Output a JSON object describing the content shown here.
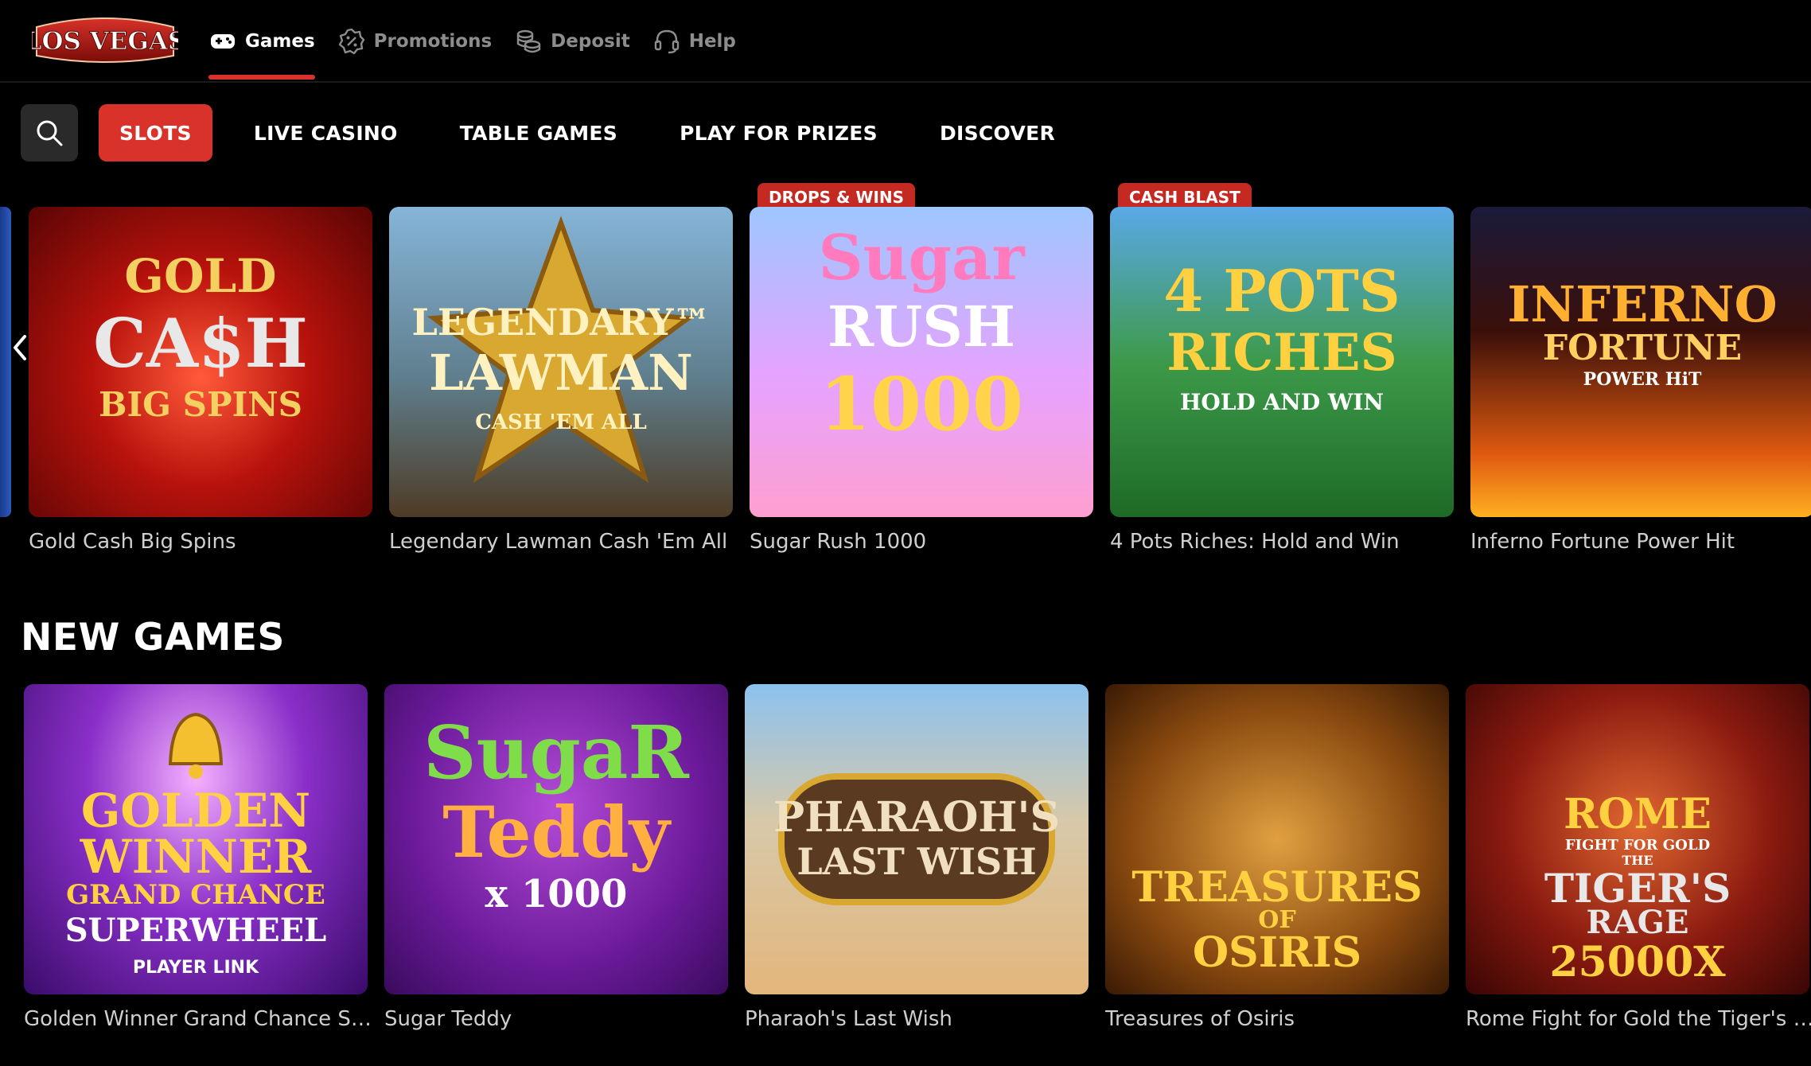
{
  "header": {
    "logo_text": "LOS VEGAS",
    "nav": [
      {
        "label": "Games",
        "icon": "gamepad-icon",
        "active": true
      },
      {
        "label": "Promotions",
        "icon": "percent-badge-icon",
        "active": false
      },
      {
        "label": "Deposit",
        "icon": "coins-icon",
        "active": false
      },
      {
        "label": "Help",
        "icon": "headset-icon",
        "active": false
      }
    ]
  },
  "categories": {
    "search_icon": "search-icon",
    "items": [
      {
        "label": "SLOTS",
        "active": true
      },
      {
        "label": "LIVE CASINO",
        "active": false
      },
      {
        "label": "TABLE GAMES",
        "active": false
      },
      {
        "label": "PLAY FOR PRIZES",
        "active": false
      },
      {
        "label": "DISCOVER",
        "active": false
      }
    ]
  },
  "featured": {
    "prev_icon": "chevron-left-icon",
    "games": [
      {
        "title": "Gold Cash Big Spins",
        "badge": "",
        "art": [
          "GOLD",
          "CA$H",
          "BIG SPINS"
        ]
      },
      {
        "title": "Legendary Lawman Cash 'Em All",
        "badge": "",
        "art": [
          "LEGENDARY™",
          "LAWMAN",
          "CASH 'EM ALL"
        ]
      },
      {
        "title": "Sugar Rush 1000",
        "badge": "DROPS & WINS",
        "art": [
          "Sugar",
          "RUSH",
          "1000"
        ]
      },
      {
        "title": "4 Pots Riches: Hold and Win",
        "badge": "CASH BLAST",
        "art": [
          "4 POTS",
          "RICHES",
          "HOLD AND WIN"
        ]
      },
      {
        "title": "Inferno Fortune Power Hit",
        "badge": "",
        "art": [
          "INFERNO",
          "FORTUNE",
          "POWER HiT"
        ]
      }
    ]
  },
  "new_games": {
    "title": "NEW GAMES",
    "games": [
      {
        "title": "Golden Winner Grand Chance Sup...",
        "art": [
          "GOLDEN",
          "WINNER",
          "GRAND CHANCE",
          "SUPERWHEEL",
          "PLAYER LINK"
        ]
      },
      {
        "title": "Sugar Teddy",
        "art": [
          "SugaR",
          "Teddy",
          "x 1000"
        ]
      },
      {
        "title": "Pharaoh's Last Wish",
        "art": [
          "PHARAOH'S",
          "LAST WISH"
        ]
      },
      {
        "title": "Treasures of Osiris",
        "art": [
          "TREASURES",
          "OF",
          "OSIRIS"
        ]
      },
      {
        "title": "Rome Fight for Gold the Tiger's Ra...",
        "art": [
          "ROME",
          "FIGHT FOR GOLD",
          "THE",
          "TIGER'S",
          "RAGE",
          "25000X"
        ]
      }
    ]
  },
  "colors": {
    "accent": "#d8322a",
    "background": "#000000",
    "muted_text": "#8d8d8d"
  }
}
